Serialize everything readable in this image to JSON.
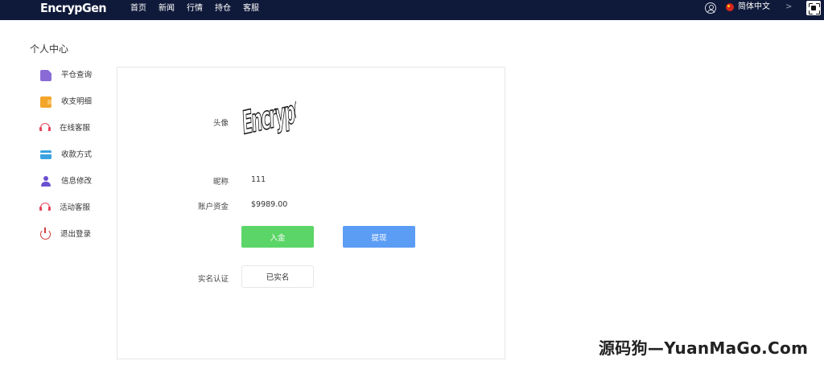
{
  "topbar": {
    "logo": "EncrypGen",
    "nav": [
      "首页",
      "新闻",
      "行情",
      "持仓",
      "客服"
    ],
    "language": "简体中文",
    "chevron": ">"
  },
  "page": {
    "title": "个人中心"
  },
  "sidebar": {
    "items": [
      {
        "label": "平仓查询",
        "icon": "document-icon"
      },
      {
        "label": "收支明细",
        "icon": "wallet-icon"
      },
      {
        "label": "在线客服",
        "icon": "headset-icon"
      },
      {
        "label": "收款方式",
        "icon": "card-icon"
      },
      {
        "label": "信息修改",
        "icon": "user-icon"
      },
      {
        "label": "活动客服",
        "icon": "headset-icon"
      },
      {
        "label": "退出登录",
        "icon": "power-icon"
      }
    ]
  },
  "profile": {
    "avatar_label": "头像",
    "avatar_text": "EncrypGen",
    "nickname_label": "昵称",
    "nickname": "111",
    "balance_label": "账户资金",
    "balance": "$9989.00",
    "deposit_label": "入金",
    "withdraw_label": "提现",
    "verify_label": "实名认证",
    "verify_status": "已实名"
  },
  "watermark": "源码狗—YuanMaGo.Com",
  "colors": {
    "topbar": "#0f1a3a",
    "deposit": "#5bd567",
    "withdraw": "#5b9cf5"
  }
}
